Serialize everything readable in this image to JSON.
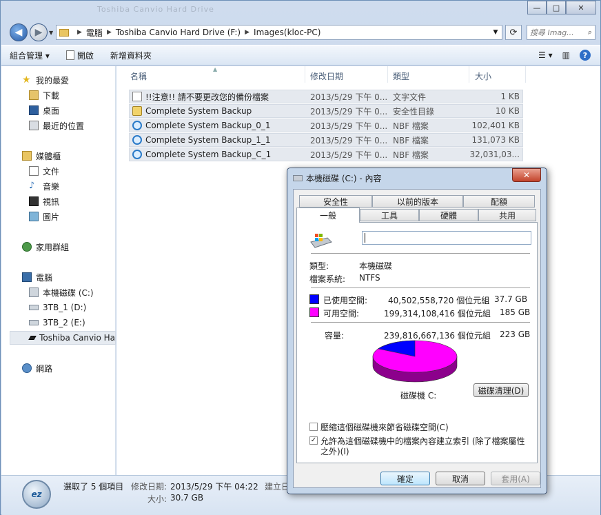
{
  "title_ghost": "Toshiba Canvio Hard Drive",
  "window_buttons": {
    "minimize": "—",
    "maximize": "□",
    "close": "✕"
  },
  "address": {
    "crumbs": [
      "電腦",
      "Toshiba Canvio Hard Drive (F:)",
      "Images(kloc-PC)"
    ],
    "search_placeholder": "搜尋 Imag..."
  },
  "toolbar": {
    "organize": "組合管理 ▾",
    "open": "開啟",
    "new_folder": "新增資料夾"
  },
  "sidebar": {
    "favorites": "我的最愛",
    "fav_items": [
      "下載",
      "桌面",
      "最近的位置"
    ],
    "libraries": "媒體櫃",
    "lib_items": [
      "文件",
      "音樂",
      "視訊",
      "圖片"
    ],
    "homegroup": "家用群組",
    "computer": "電腦",
    "drives": [
      "本機磁碟 (C:)",
      "3TB_1 (D:)",
      "3TB_2 (E:)",
      "Toshiba Canvio Ha"
    ],
    "network": "網路"
  },
  "columns": {
    "name": "名稱",
    "date": "修改日期",
    "type": "類型",
    "size": "大小"
  },
  "files": [
    {
      "name": "!!注意!! 請不要更改您的備份檔案",
      "date": "2013/5/29 下午 0...",
      "type": "文字文件",
      "size": "1 KB",
      "icon": "text-file-icon"
    },
    {
      "name": "Complete System Backup",
      "date": "2013/5/29 下午 0...",
      "type": "安全性目錄",
      "size": "10 KB",
      "icon": "security-catalog-icon"
    },
    {
      "name": "Complete System Backup_0_1",
      "date": "2013/5/29 下午 0...",
      "type": "NBF 檔案",
      "size": "102,401 KB",
      "icon": "nbf-file-icon"
    },
    {
      "name": "Complete System Backup_1_1",
      "date": "2013/5/29 下午 0...",
      "type": "NBF 檔案",
      "size": "131,073 KB",
      "icon": "nbf-file-icon"
    },
    {
      "name": "Complete System Backup_C_1",
      "date": "2013/5/29 下午 0...",
      "type": "NBF 檔案",
      "size": "32,031,03...",
      "icon": "nbf-file-icon"
    }
  ],
  "status": {
    "selected": "選取了 5 個項目",
    "modified_label": "修改日期:",
    "modified_value": "2013/5/29 下午 04:22",
    "created_label": "建立日",
    "size_label": "大小:",
    "size_value": "30.7 GB",
    "badge": "ez"
  },
  "dialog": {
    "title": "本機磁碟 (C:) - 內容",
    "tabs_top": [
      "安全性",
      "以前的版本",
      "配額"
    ],
    "tabs_bottom": [
      "一般",
      "工具",
      "硬體",
      "共用"
    ],
    "drive_name_value": "",
    "type_label": "類型:",
    "type_value": "本機磁碟",
    "fs_label": "檔案系統:",
    "fs_value": "NTFS",
    "used_label": "已使用空間:",
    "used_bytes": "40,502,558,720 個位元組",
    "used_gb": "37.7 GB",
    "free_label": "可用空間:",
    "free_bytes": "199,314,108,416 個位元組",
    "free_gb": "185 GB",
    "capacity_label": "容量:",
    "capacity_bytes": "239,816,667,136 個位元組",
    "capacity_gb": "223 GB",
    "used_color": "#0000ff",
    "free_color": "#ff00ff",
    "used_fraction": 0.169,
    "drive_label": "磁碟機 C:",
    "cleanup_button": "磁碟清理(D)",
    "compress_label": "壓縮這個磁碟機來節省磁碟空間(C)",
    "compress_checked": false,
    "index_label_1": "允許為這個磁碟機中的檔案內容建立索引 (除了檔案屬性",
    "index_label_2": "之外)(I)",
    "index_checked": true,
    "ok": "確定",
    "cancel": "取消",
    "apply": "套用(A)"
  }
}
